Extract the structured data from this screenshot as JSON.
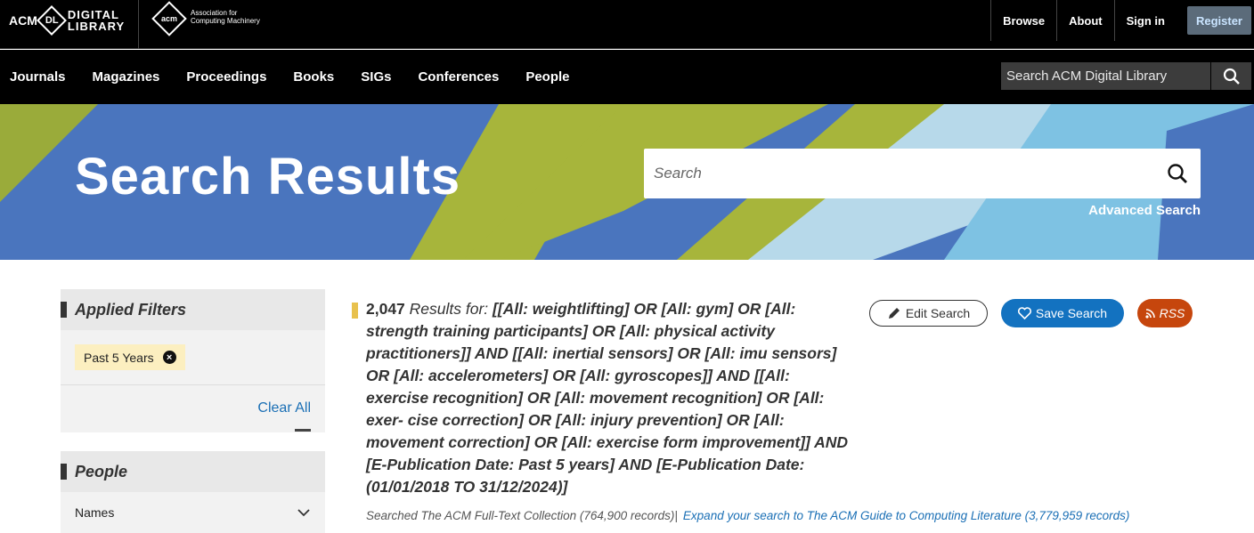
{
  "brand": {
    "acm_text": "ACM",
    "dl_text": "DL",
    "digital_text": "DIGITAL",
    "library_text": "LIBRARY",
    "assoc_logo_text": "acm",
    "assoc_text": "Association for Computing Machinery"
  },
  "topnav": {
    "browse": "Browse",
    "about": "About",
    "signin": "Sign in",
    "register": "Register"
  },
  "mainnav": {
    "items": [
      "Journals",
      "Magazines",
      "Proceedings",
      "Books",
      "SIGs",
      "Conferences",
      "People"
    ],
    "search_placeholder": "Search ACM Digital Library"
  },
  "banner": {
    "title": "Search Results",
    "search_placeholder": "Search",
    "advanced": "Advanced Search"
  },
  "filters": {
    "title": "Applied Filters",
    "chip": "Past 5 Years",
    "chip_remove": "×",
    "clear_all": "Clear All"
  },
  "people": {
    "title": "People",
    "names_label": "Names"
  },
  "results": {
    "count": "2,047",
    "label": "Results for:",
    "query": "[[All: weightlifting] OR [All: gym] OR [All: strength training participants] OR [All: physical activity practitioners]] AND [[All: inertial sensors] OR [All: imu sensors] OR [All: accelerometers] OR [All: gyroscopes]] AND [[All: exercise recognition] OR [All: movement recognition] OR [All: exer- cise correction] OR [All: injury prevention] OR [All: movement correction] OR [All: exercise form improvement]] AND [E-Publication Date: Past 5 years] AND [E-Publication Date: (01/01/2018 TO 31/12/2024)]",
    "searched": "Searched The ACM Full-Text Collection (764,900 records)|",
    "expand": "Expand your search to The ACM Guide to Computing Literature (3,779,959 records)"
  },
  "actions": {
    "edit": "Edit Search",
    "save": "Save Search",
    "rss": "RSS"
  },
  "colors": {
    "banner_blue": "#4a75be",
    "save_blue": "#1372c0",
    "rss_orange": "#c6460d",
    "link_blue": "#1a6fb5",
    "chip_bg": "#fcefc0"
  }
}
